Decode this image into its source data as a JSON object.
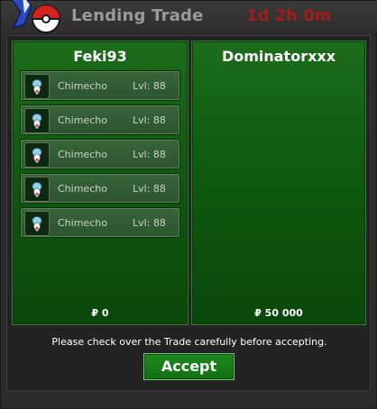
{
  "window": {
    "title": "Lending Trade",
    "timer": "1d 2h 0m"
  },
  "left_panel": {
    "player": "Feki93",
    "items": [
      {
        "name": "Chimecho",
        "level": "Lvl: 88",
        "icon": "chimecho-sprite-icon"
      },
      {
        "name": "Chimecho",
        "level": "Lvl: 88",
        "icon": "chimecho-sprite-icon"
      },
      {
        "name": "Chimecho",
        "level": "Lvl: 88",
        "icon": "chimecho-sprite-icon"
      },
      {
        "name": "Chimecho",
        "level": "Lvl: 88",
        "icon": "chimecho-sprite-icon"
      },
      {
        "name": "Chimecho",
        "level": "Lvl: 88",
        "icon": "chimecho-sprite-icon"
      }
    ],
    "money": "₽ 0"
  },
  "right_panel": {
    "player": "Dominatorxxx",
    "money": "₽ 50 000"
  },
  "footer": {
    "notice": "Please check over the Trade carefully before accepting.",
    "accept_label": "Accept"
  },
  "colors": {
    "timer": "#a31b1b",
    "panel_green": "#0e560e",
    "accept_green": "#1f8a1f"
  }
}
